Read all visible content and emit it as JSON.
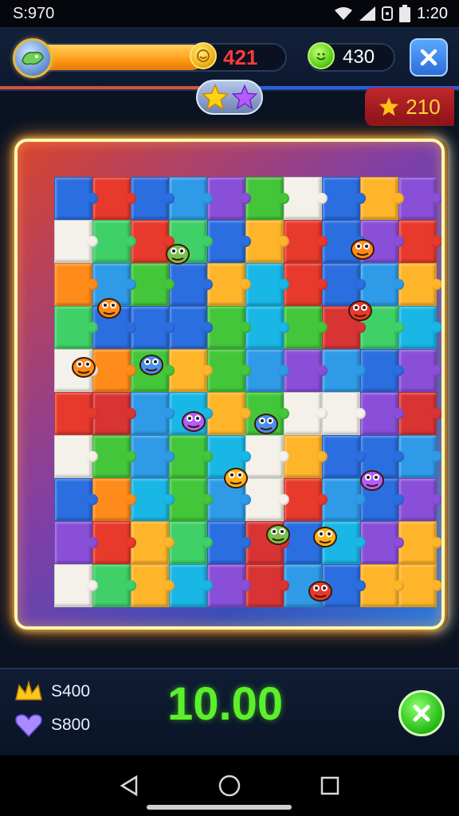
{
  "status": {
    "time_left": "S:970",
    "time_right": "1:20"
  },
  "hud": {
    "score": "421",
    "gems": "430",
    "progress": 0.68,
    "star_score": "210"
  },
  "bottom": {
    "resource1": "S400",
    "resource2": "S800",
    "timer": "10.00"
  },
  "colors": {
    "accent": "#5cf02a",
    "score": "#ff3b3b",
    "frame": "#fff7b0"
  },
  "icons": {
    "status": [
      "wifi-icon",
      "signal-icon",
      "alarm-icon",
      "battery-icon"
    ],
    "nav": [
      "back-icon",
      "home-icon",
      "recents-icon"
    ]
  }
}
